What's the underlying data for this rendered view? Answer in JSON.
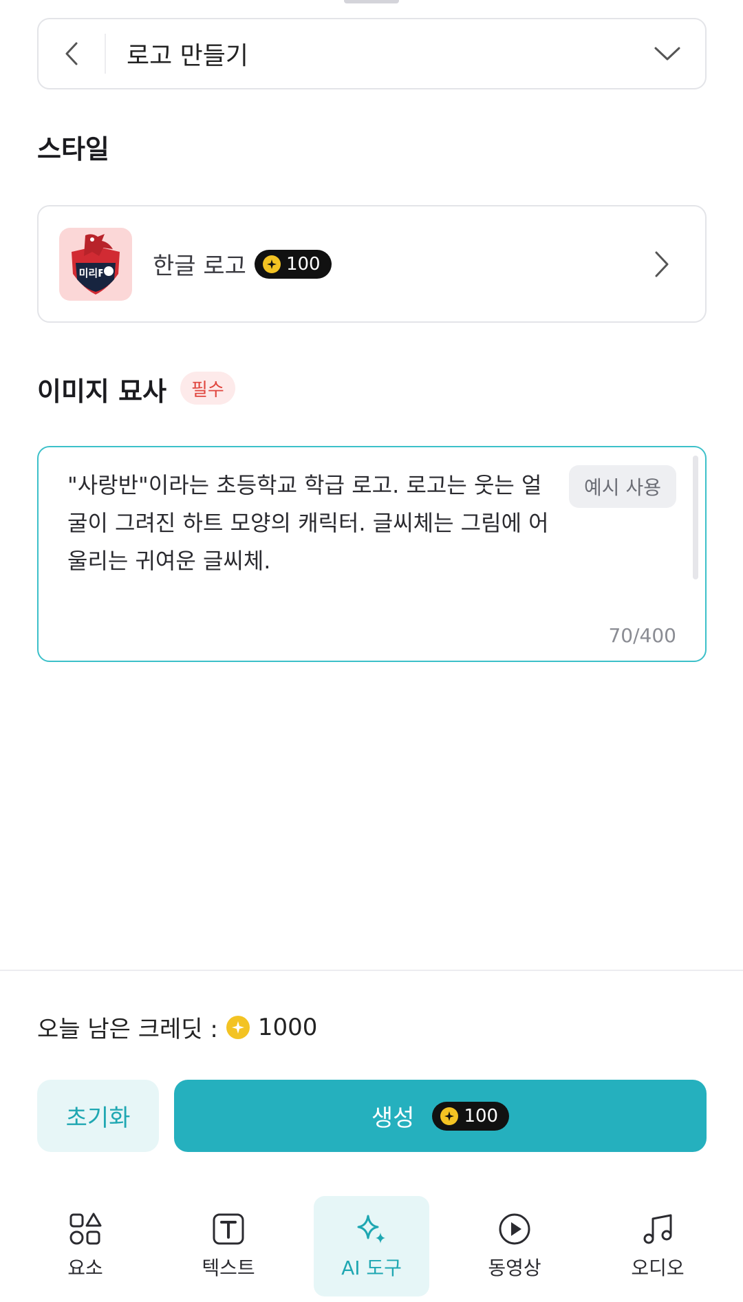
{
  "selector": {
    "title": "로고 만들기"
  },
  "style_section": {
    "heading": "스타일",
    "card": {
      "name": "한글 로고",
      "credit": "100",
      "thumb_text": "미리FC"
    }
  },
  "description_section": {
    "heading": "이미지 묘사",
    "required_label": "필수",
    "text": "\"사랑반\"이라는 초등학교 학급 로고. 로고는 웃는 얼굴이 그려진 하트 모양의 캐릭터. 글씨체는 그림에 어울리는 귀여운 글씨체.",
    "example_button": "예시 사용",
    "counter": "70/400"
  },
  "credits": {
    "label": "오늘 남은 크레딧 :",
    "amount": "1000"
  },
  "actions": {
    "reset_label": "초기화",
    "generate_label": "생성",
    "generate_credit": "100"
  },
  "nav": [
    {
      "label": "요소",
      "icon": "shapes-icon"
    },
    {
      "label": "텍스트",
      "icon": "text-t-icon"
    },
    {
      "label": "AI 도구",
      "icon": "sparkle-icon",
      "active": true
    },
    {
      "label": "동영상",
      "icon": "play-circle-icon"
    },
    {
      "label": "오디오",
      "icon": "music-note-icon"
    }
  ],
  "colors": {
    "accent": "#25b0be",
    "required": "#e0463f",
    "coin": "#f3c323"
  }
}
